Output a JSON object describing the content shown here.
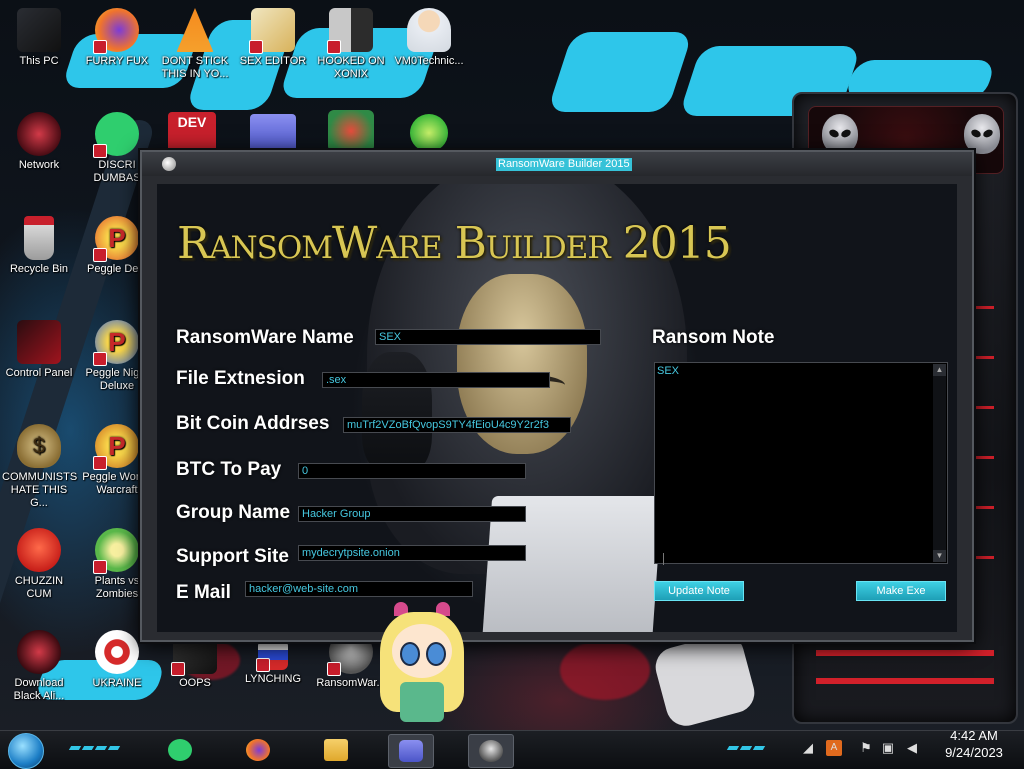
{
  "desktop": {
    "icons": [
      {
        "label": "This PC"
      },
      {
        "label": "FURRY FUX"
      },
      {
        "label": "DONT STICK THIS IN YO..."
      },
      {
        "label": "SEX EDITOR"
      },
      {
        "label": "HOOKED ON XONIX"
      },
      {
        "label": "VM0Technic..."
      },
      {
        "label": "Network"
      },
      {
        "label": "DISCRI DUMBAS"
      },
      {
        "label": "Recycle Bin"
      },
      {
        "label": "Peggle Delu"
      },
      {
        "label": "Control Panel"
      },
      {
        "label": "Peggle Night Deluxe"
      },
      {
        "label": "COMMUNISTS HATE THIS G..."
      },
      {
        "label": "Peggle Wor of Warcraft"
      },
      {
        "label": "CHUZZIN CUM"
      },
      {
        "label": "Plants vs Zombies"
      },
      {
        "label": "Download Black Ali..."
      },
      {
        "label": "UKRAINE"
      },
      {
        "label": "OOPS"
      },
      {
        "label": "LYNCHING"
      },
      {
        "label": "RansomWar..."
      }
    ],
    "accent_color": "#2ec6ea"
  },
  "window": {
    "title": "RansomWare Builder 2015",
    "heading": "RansomWare Builder 2015",
    "form": {
      "name_label": "RansomWare Name",
      "name_value": "SEX",
      "ext_label": "File Extnesion",
      "ext_value": ".sex",
      "btc_label": "Bit Coin Addrses",
      "btc_value": "muTrf2VZoBfQvopS9TY4fEioU4c9Y2r2f3",
      "pay_label": "BTC To Pay",
      "pay_value": "0",
      "group_label": "Group Name",
      "group_value": "Hacker Group",
      "site_label": "Support Site",
      "site_value": "mydecrytpsite.onion",
      "email_label": "E Mail",
      "email_value": "hacker@web-site.com"
    },
    "note": {
      "label": "Ransom Note",
      "text": "SEX"
    },
    "buttons": {
      "update": "Update Note",
      "make": "Make Exe"
    },
    "title_color": "#d8c653",
    "field_text_color": "#46c8e0"
  },
  "taskbar": {
    "time": "4:42 AM",
    "date": "9/24/2023"
  }
}
